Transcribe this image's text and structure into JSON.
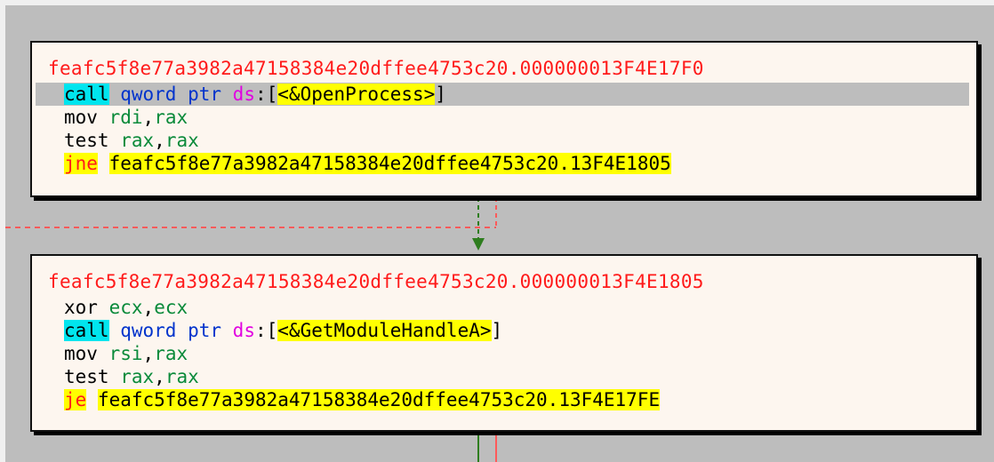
{
  "block1": {
    "title": "feafc5f8e77a3982a47158384e20dffee4753c20.000000013F4E17F0",
    "lines": [
      {
        "mnemonic": "call",
        "op_a": "qword ptr ",
        "seg": "ds",
        "colon": ":",
        "lb": "[",
        "target": "<&OpenProcess>",
        "rb": "]"
      },
      {
        "mnemonic": "mov",
        "dest": "rdi",
        "sep": ",",
        "src": "rax"
      },
      {
        "mnemonic": "test",
        "dest": "rax",
        "sep": ",",
        "src": "rax"
      },
      {
        "mnemonic": "jne",
        "target": "feafc5f8e77a3982a47158384e20dffee4753c20.13F4E1805"
      }
    ]
  },
  "block2": {
    "title": "feafc5f8e77a3982a47158384e20dffee4753c20.000000013F4E1805",
    "lines": [
      {
        "mnemonic": "xor",
        "dest": "ecx",
        "sep": ",",
        "src": "ecx"
      },
      {
        "mnemonic": "call",
        "op_a": "qword ptr ",
        "seg": "ds",
        "colon": ":",
        "lb": "[",
        "target": "<&GetModuleHandleA>",
        "rb": "]"
      },
      {
        "mnemonic": "mov",
        "dest": "rsi",
        "sep": ",",
        "src": "rax"
      },
      {
        "mnemonic": "test",
        "dest": "rax",
        "sep": ",",
        "src": "rax"
      },
      {
        "mnemonic": "je",
        "target": "feafc5f8e77a3982a47158384e20dffee4753c20.13F4E17FE"
      }
    ]
  },
  "colors": {
    "background": "#bdbdbd",
    "block_bg": "#fdf6ef",
    "address_red": "#ff1a1a",
    "call_highlight": "#00e5ee",
    "jump_highlight": "#ffff00",
    "register_green": "#0a8a3a",
    "keyword_blue": "#0033cc",
    "segment_magenta": "#e100e1",
    "edge_true_green": "#2e7d1e",
    "edge_false_red": "#ff5a5a"
  }
}
